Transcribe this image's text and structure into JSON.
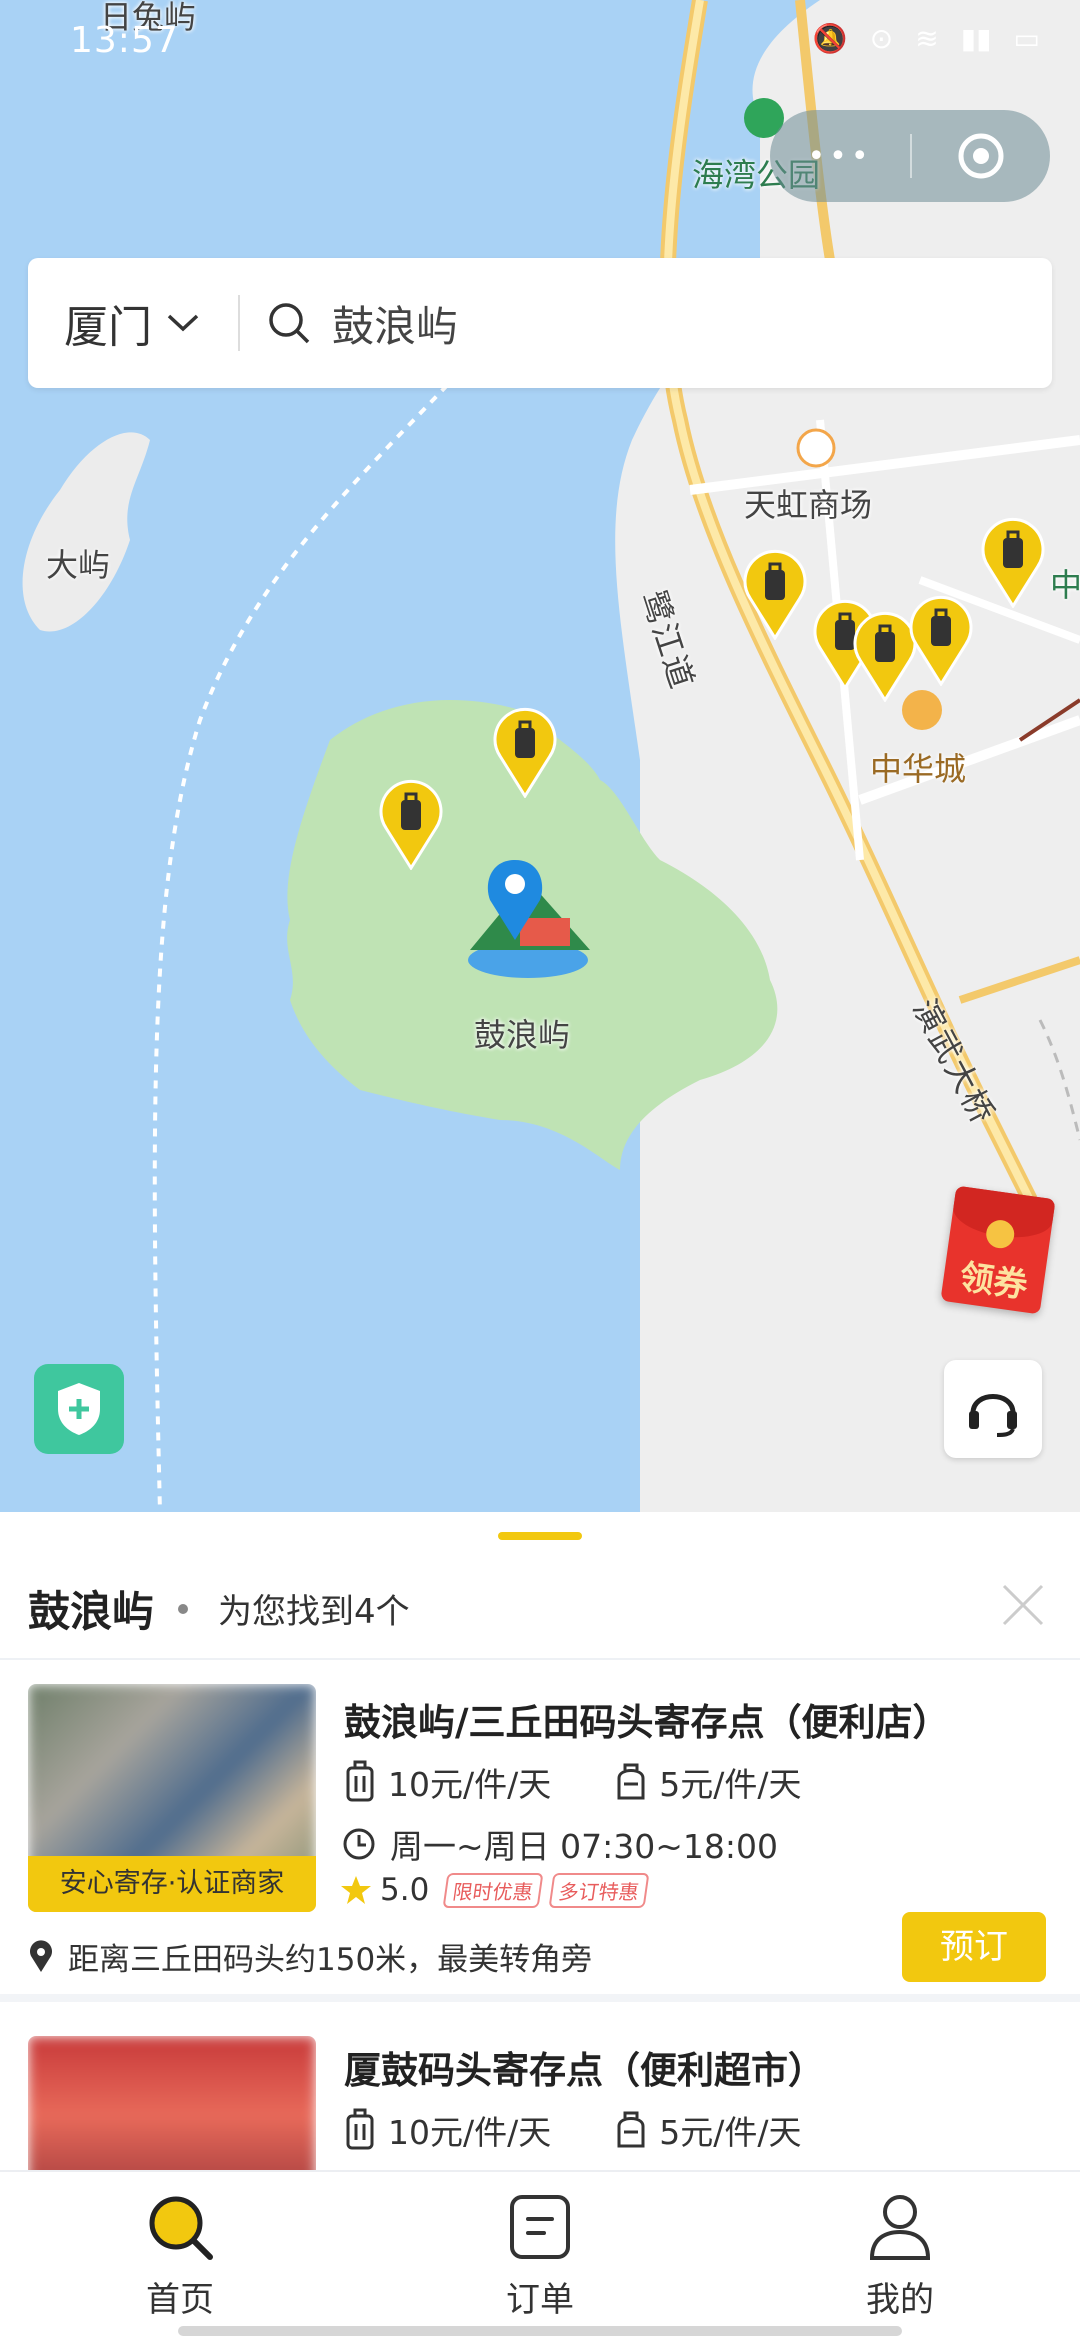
{
  "status_bar": {
    "time": "13:57"
  },
  "map": {
    "labels": {
      "top_left": "日兔屿",
      "park": "海湾公园",
      "big_island": "大屿",
      "mall": "天虹商场",
      "road_lujiang": "鹭江道",
      "zhonghua": "中华城",
      "gulangyu": "鼓浪屿",
      "bridge": "演武大桥",
      "edge": "中"
    },
    "marker_count_city": 5,
    "marker_count_island": 2
  },
  "search": {
    "city": "厦门",
    "query": "鼓浪屿"
  },
  "floating": {
    "coupon_label": "领券"
  },
  "sheet": {
    "title": "鼓浪屿",
    "result_text": "为您找到4个",
    "stores": [
      {
        "name": "鼓浪屿/三丘田码头寄存点（便利店）",
        "price_luggage": "10元/件/天",
        "price_bag": "5元/件/天",
        "hours": "周一~周日 07:30~18:00",
        "rating": "5.0",
        "tags": [
          "限时优惠",
          "多订特惠"
        ],
        "badge": "安心寄存·认证商家",
        "distance": "距离三丘田码头约150米，最美转角旁",
        "book_label": "预订"
      },
      {
        "name": "厦鼓码头寄存点（便利超市）",
        "price_luggage": "10元/件/天",
        "price_bag": "5元/件/天"
      }
    ]
  },
  "tabs": [
    {
      "label": "首页",
      "active": true
    },
    {
      "label": "订单",
      "active": false
    },
    {
      "label": "我的",
      "active": false
    }
  ],
  "colors": {
    "accent": "#f2c80f",
    "water": "#a9d2f5",
    "island": "#bfe3b4",
    "shield": "#3fc79e",
    "coupon": "#e8332c"
  }
}
